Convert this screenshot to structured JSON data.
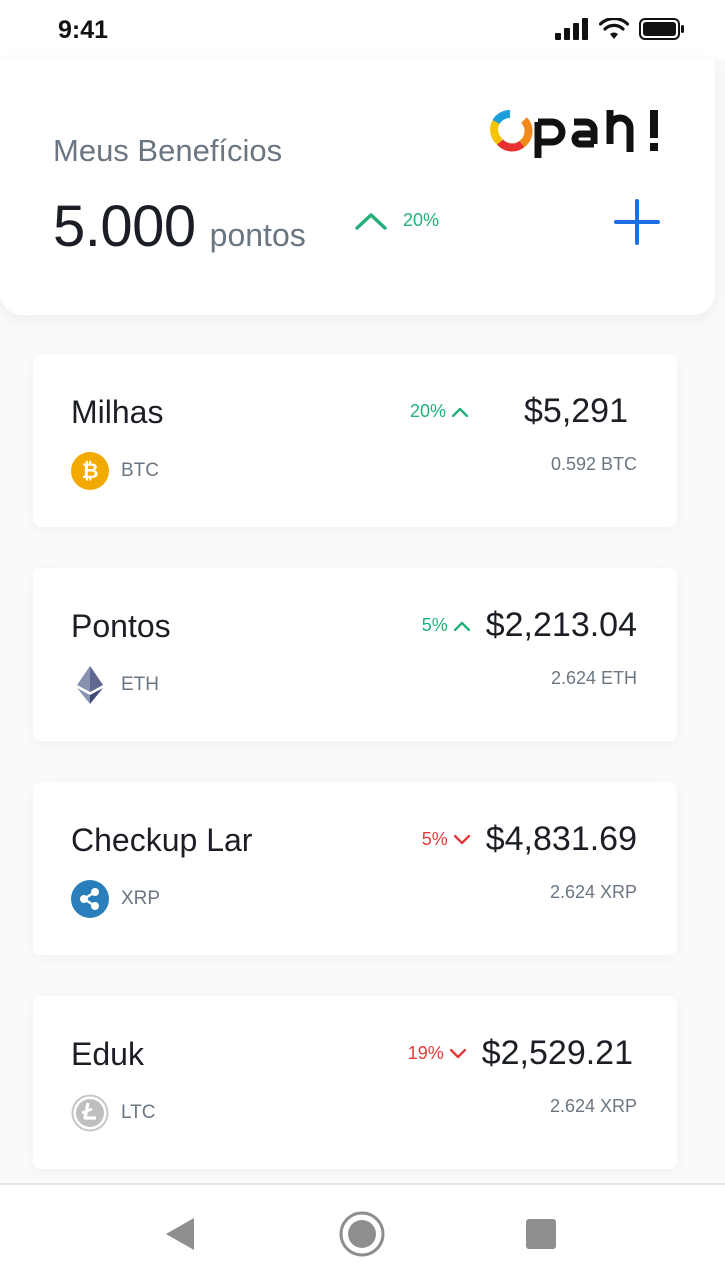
{
  "status_bar": {
    "time": "9:41",
    "icons": [
      "signal-icon",
      "wifi-icon",
      "battery-icon"
    ]
  },
  "header": {
    "title": "Meus Benefícios",
    "logo_text": "opah!",
    "points_value": "5.000",
    "points_unit": "pontos",
    "trend_percent": "20%",
    "trend_direction": "up",
    "add_icon": "plus-icon"
  },
  "cards": [
    {
      "name": "Milhas",
      "change": "20%",
      "direction": "up",
      "value": "$5,291",
      "coin": "BTC",
      "coin_icon": "bitcoin-icon",
      "amount": "0.592 BTC"
    },
    {
      "name": "Pontos",
      "change": "5%",
      "direction": "up",
      "value": "$2,213.04",
      "coin": "ETH",
      "coin_icon": "ethereum-icon",
      "amount": "2.624 ETH"
    },
    {
      "name": "Checkup Lar",
      "change": "5%",
      "direction": "down",
      "value": "$4,831.69",
      "coin": "XRP",
      "coin_icon": "ripple-icon",
      "amount": "2.624 XRP"
    },
    {
      "name": "Eduk",
      "change": "19%",
      "direction": "down",
      "value": "$2,529.21",
      "coin": "LTC",
      "coin_icon": "litecoin-icon",
      "amount": "2.624 XRP"
    }
  ],
  "nav": {
    "buttons": [
      "back-icon",
      "home-icon",
      "recents-icon"
    ]
  },
  "colors": {
    "up": "#23b079",
    "down": "#e23b3b",
    "accent": "#1b6fe0",
    "muted": "#6b7683",
    "btc": "#f2a900",
    "xrp": "#2a7fbb"
  }
}
